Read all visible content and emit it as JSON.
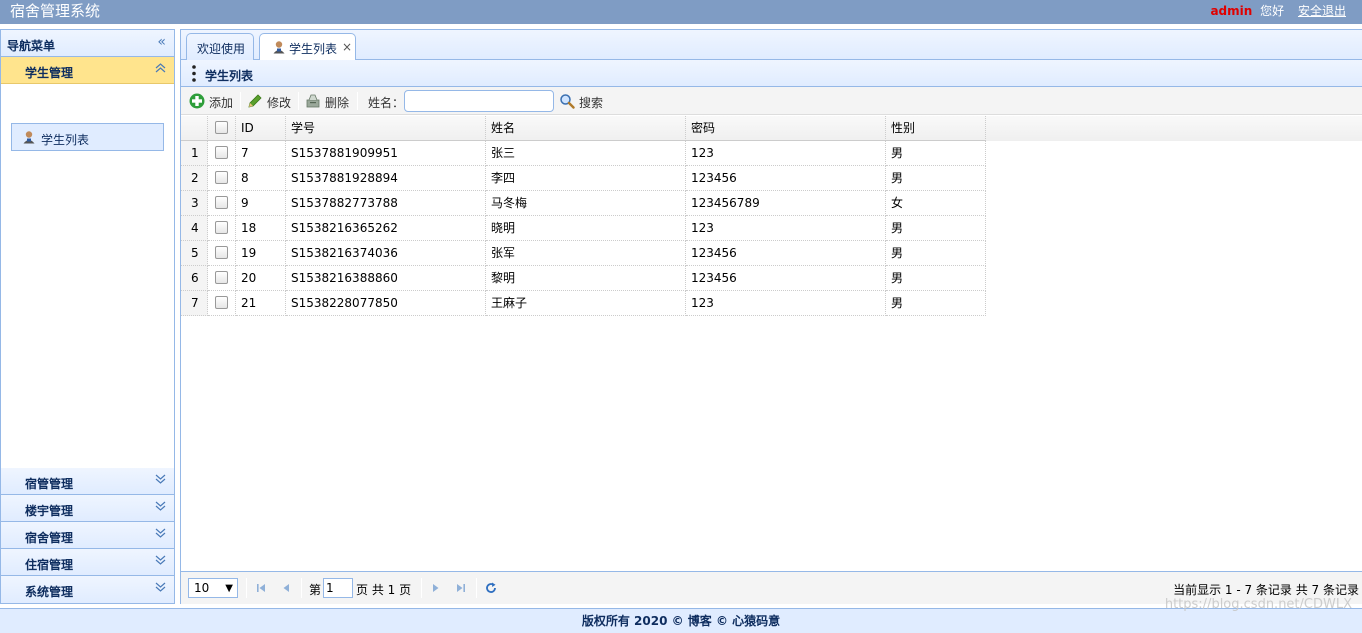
{
  "header": {
    "title": "宿舍管理系统",
    "user": "admin",
    "greeting": "您好",
    "logout": "安全退出"
  },
  "sidebar": {
    "title": "导航菜单",
    "active_group": "学生管理",
    "active_item": "学生列表",
    "groups": [
      "宿管管理",
      "楼宇管理",
      "宿舍管理",
      "住宿管理",
      "系统管理"
    ]
  },
  "tabs": [
    {
      "label": "欢迎使用"
    },
    {
      "label": "学生列表",
      "close": "×"
    }
  ],
  "panel": {
    "title": "学生列表"
  },
  "toolbar": {
    "add": "添加",
    "edit": "修改",
    "delete": "删除",
    "search_label": "姓名：",
    "search_value": "",
    "search_button": "搜索"
  },
  "table": {
    "columns": [
      "ID",
      "学号",
      "姓名",
      "密码",
      "性别"
    ],
    "rows": [
      {
        "num": "1",
        "id": "7",
        "sno": "S1537881909951",
        "name": "张三",
        "pwd": "123",
        "sex": "男"
      },
      {
        "num": "2",
        "id": "8",
        "sno": "S1537881928894",
        "name": "李四",
        "pwd": "123456",
        "sex": "男"
      },
      {
        "num": "3",
        "id": "9",
        "sno": "S1537882773788",
        "name": "马冬梅",
        "pwd": "123456789",
        "sex": "女"
      },
      {
        "num": "4",
        "id": "18",
        "sno": "S1538216365262",
        "name": "晓明",
        "pwd": "123",
        "sex": "男"
      },
      {
        "num": "5",
        "id": "19",
        "sno": "S1538216374036",
        "name": "张军",
        "pwd": "123456",
        "sex": "男"
      },
      {
        "num": "6",
        "id": "20",
        "sno": "S1538216388860",
        "name": "黎明",
        "pwd": "123456",
        "sex": "男"
      },
      {
        "num": "7",
        "id": "21",
        "sno": "S1538228077850",
        "name": "王麻子",
        "pwd": "123",
        "sex": "男"
      }
    ]
  },
  "pager": {
    "page_size": "10",
    "page_prefix": "第",
    "page_value": "1",
    "page_suffix": "页 共 1 页",
    "info": "当前显示 1 - 7 条记录 共 7 条记录"
  },
  "footer": {
    "text": "版权所有 2020 © 博客 © 心猿码意"
  },
  "watermark": "https://blog.csdn.net/CDWLX",
  "colors": {
    "accent": "#95b8e7",
    "header_bg": "#7f9cc4",
    "active_group": "#ffe48d",
    "user_name": "#e00000"
  }
}
